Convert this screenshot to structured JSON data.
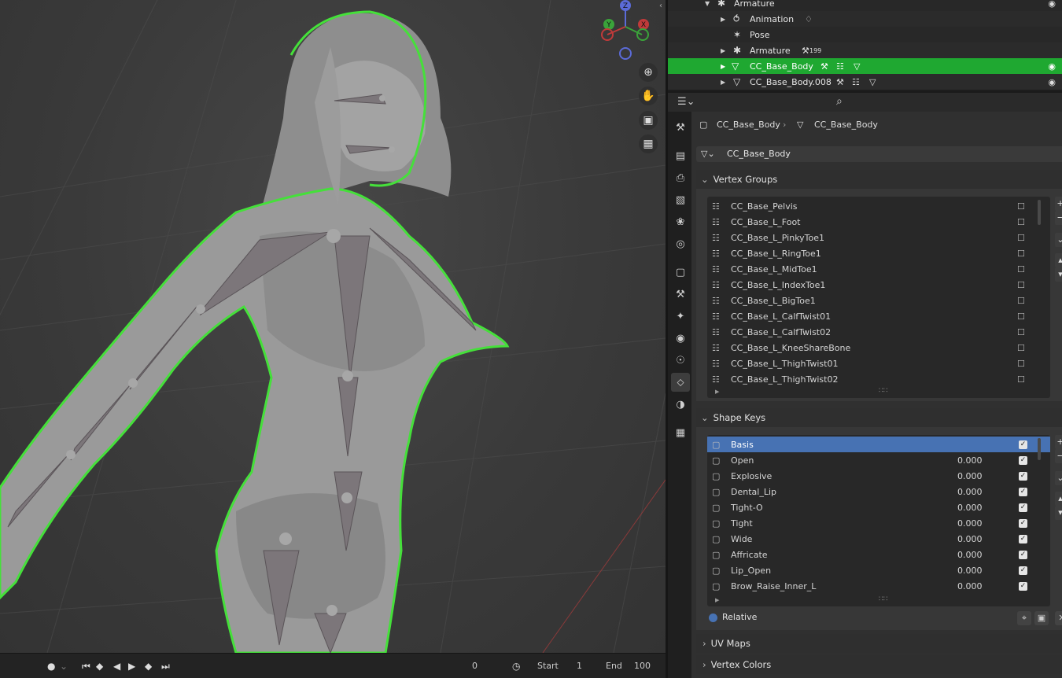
{
  "outliner": {
    "rows": [
      {
        "label": "Armature",
        "icon": "armature-object-icon",
        "expanded": true
      },
      {
        "label": "Animation",
        "icon": "animation-icon"
      },
      {
        "label": "Pose",
        "icon": "pose-icon"
      },
      {
        "label": "Armature",
        "icon": "armature-data-icon",
        "extra": "199"
      },
      {
        "label": "CC_Base_Body",
        "icon": "mesh-icon",
        "selected": true
      },
      {
        "label": "CC_Base_Body.008",
        "icon": "mesh-icon"
      }
    ]
  },
  "properties": {
    "breadcrumb": {
      "object": "CC_Base_Body",
      "data": "CC_Base_Body"
    },
    "mesh_selector": "CC_Base_Body",
    "vertex_groups": {
      "title": "Vertex Groups",
      "items": [
        "CC_Base_Pelvis",
        "CC_Base_L_Foot",
        "CC_Base_L_PinkyToe1",
        "CC_Base_L_RingToe1",
        "CC_Base_L_MidToe1",
        "CC_Base_L_IndexToe1",
        "CC_Base_L_BigToe1",
        "CC_Base_L_CalfTwist01",
        "CC_Base_L_CalfTwist02",
        "CC_Base_L_KneeShareBone",
        "CC_Base_L_ThighTwist01",
        "CC_Base_L_ThighTwist02"
      ]
    },
    "shape_keys": {
      "title": "Shape Keys",
      "items": [
        {
          "name": "Basis",
          "value": "",
          "selected": true
        },
        {
          "name": "Open",
          "value": "0.000"
        },
        {
          "name": "Explosive",
          "value": "0.000"
        },
        {
          "name": "Dental_Lip",
          "value": "0.000"
        },
        {
          "name": "Tight-O",
          "value": "0.000"
        },
        {
          "name": "Tight",
          "value": "0.000"
        },
        {
          "name": "Wide",
          "value": "0.000"
        },
        {
          "name": "Affricate",
          "value": "0.000"
        },
        {
          "name": "Lip_Open",
          "value": "0.000"
        },
        {
          "name": "Brow_Raise_Inner_L",
          "value": "0.000"
        }
      ],
      "relative_label": "Relative"
    },
    "uv_maps_title": "UV Maps",
    "vertex_colors_title": "Vertex Colors"
  },
  "timeline": {
    "current_frame": "0",
    "start_label": "Start",
    "start_value": "1",
    "end_label": "End",
    "end_value": "100"
  },
  "gizmo": {
    "z": "Z",
    "y": "Y",
    "x": "X"
  },
  "colors": {
    "selection_green": "#1fa831",
    "active_blue": "#4772b3",
    "outline_green": "#45e03a"
  }
}
